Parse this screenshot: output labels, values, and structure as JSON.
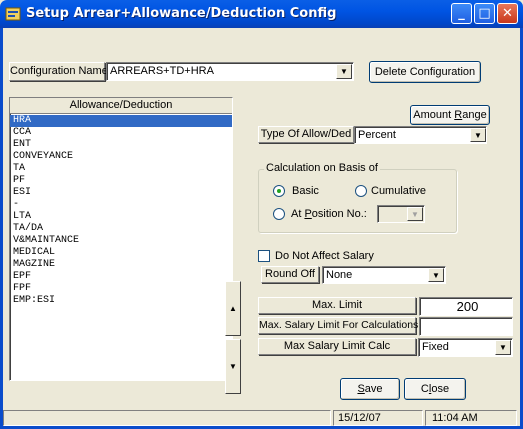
{
  "window": {
    "title": "Setup Arrear+Allowance/Deduction Config",
    "minimize": "_",
    "maximize": "□",
    "close": "✕"
  },
  "config": {
    "label": "Configuration Name",
    "value": "ARREARS+TD+HRA",
    "delete_button": "Delete Configuration"
  },
  "list": {
    "header": "Allowance/Deduction",
    "items": [
      "HRA",
      "CCA",
      "ENT",
      "CONVEYANCE",
      "TA",
      "PF",
      "ESI",
      "-",
      "LTA",
      "TA/DA",
      "V&MAINTANCE",
      "MEDICAL",
      "MAGZINE",
      "EPF",
      "FPF",
      "EMP:ESI"
    ],
    "selected_index": 0,
    "move_up_icon": "▲",
    "move_down_icon": "▼"
  },
  "amount_range": {
    "label_pre": "Amount ",
    "label_key": "R",
    "label_post": "ange"
  },
  "type_of_allow": {
    "label": "Type Of Allow/Ded",
    "value": "Percent"
  },
  "calculation": {
    "title": "Calculation on Basis of",
    "basic": "Basic",
    "cumulative": "Cumulative",
    "at_position_pre": "At ",
    "at_position_key": "P",
    "at_position_post": "osition No.:",
    "selected": "basic",
    "position_value": ""
  },
  "do_not_affect": {
    "label": "Do Not Affect Salary",
    "checked": false
  },
  "round_off": {
    "label": "Round Off",
    "value": "None"
  },
  "max_limit": {
    "label": "Max. Limit",
    "value": "200"
  },
  "max_salary_limit": {
    "label": "Max. Salary Limit For Calculations",
    "value": ""
  },
  "max_salary_calc": {
    "label": "Max Salary Limit Calc",
    "value": "Fixed"
  },
  "buttons": {
    "save_key": "S",
    "save_rest": "ave",
    "close_pre": "C",
    "close_key": "l",
    "close_rest": "ose"
  },
  "status": {
    "date": "15/12/07",
    "time": "11:04 AM"
  },
  "dropdown_icon": "▼"
}
